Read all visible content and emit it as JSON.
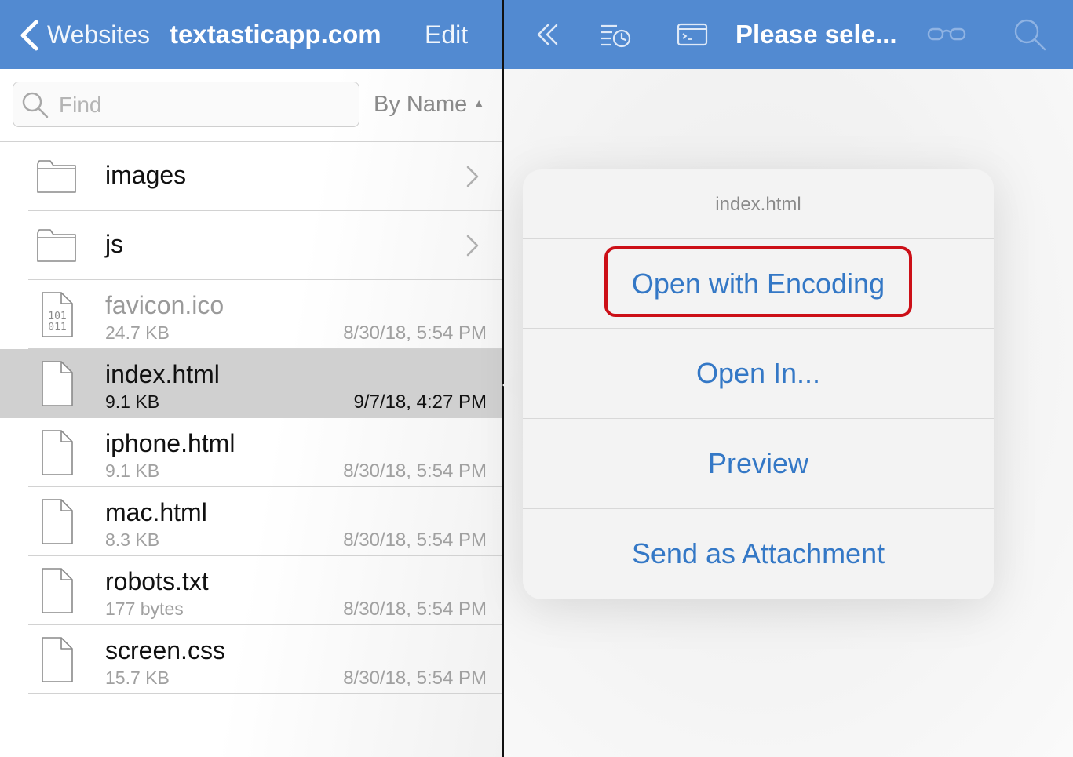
{
  "left_nav": {
    "back_label": "Websites",
    "title": "textasticapp.com",
    "edit_label": "Edit"
  },
  "search": {
    "placeholder": "Find",
    "value": ""
  },
  "sort": {
    "label": "By Name",
    "arrow": "▲"
  },
  "files": [
    {
      "name": "images",
      "kind": "folder",
      "icon": "folder-icon"
    },
    {
      "name": "js",
      "kind": "folder",
      "icon": "folder-icon"
    },
    {
      "name": "favicon.ico",
      "kind": "binary",
      "icon": "binary-file-icon",
      "size": "24.7 KB",
      "date": "8/30/18, 5:54 PM",
      "dimmed": true
    },
    {
      "name": "index.html",
      "kind": "file",
      "icon": "document-icon",
      "size": "9.1 KB",
      "date": "9/7/18, 4:27 PM",
      "selected": true
    },
    {
      "name": "iphone.html",
      "kind": "file",
      "icon": "document-icon",
      "size": "9.1 KB",
      "date": "8/30/18, 5:54 PM"
    },
    {
      "name": "mac.html",
      "kind": "file",
      "icon": "document-icon",
      "size": "8.3 KB",
      "date": "8/30/18, 5:54 PM"
    },
    {
      "name": "robots.txt",
      "kind": "file",
      "icon": "document-icon",
      "size": "177 bytes",
      "date": "8/30/18, 5:54 PM"
    },
    {
      "name": "screen.css",
      "kind": "file",
      "icon": "document-icon",
      "size": "15.7 KB",
      "date": "8/30/18, 5:54 PM"
    }
  ],
  "right_nav": {
    "title": "Please sele...",
    "icons": [
      "double-chevron-left-icon",
      "recent-files-icon",
      "terminal-icon",
      "reading-glasses-icon",
      "search-icon"
    ]
  },
  "popover": {
    "title": "index.html",
    "items": [
      {
        "label": "Open with Encoding",
        "highlighted": true
      },
      {
        "label": "Open In..."
      },
      {
        "label": "Preview"
      },
      {
        "label": "Send as Attachment"
      }
    ]
  },
  "colors": {
    "nav_bar": "#528ad1",
    "action_text": "#3478c6",
    "highlight": "#cc0f17",
    "selected_row": "#d0d0d0"
  }
}
